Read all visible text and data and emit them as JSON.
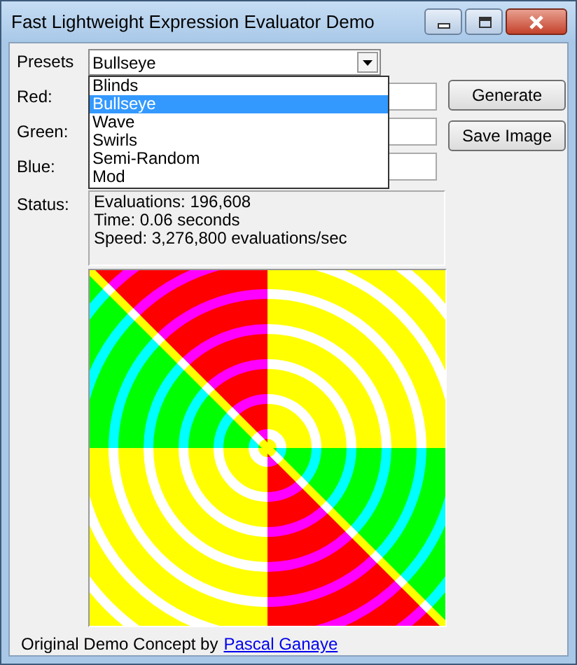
{
  "window": {
    "title": "Fast Lightweight Expression Evaluator Demo"
  },
  "presets": {
    "label": "Presets",
    "value": "Bullseye",
    "expanded": true,
    "options": [
      {
        "label": "Blinds",
        "selected": false
      },
      {
        "label": "Bullseye",
        "selected": true
      },
      {
        "label": "Wave",
        "selected": false
      },
      {
        "label": "Swirls",
        "selected": false
      },
      {
        "label": "Semi-Random",
        "selected": false
      },
      {
        "label": "Mod",
        "selected": false
      }
    ]
  },
  "fields": [
    {
      "label": "Red:"
    },
    {
      "label": "Green:"
    },
    {
      "label": "Blue:"
    }
  ],
  "buttons": [
    "Generate",
    "Save Image"
  ],
  "status": {
    "label": "Status:",
    "lines": [
      "Evaluations: 196,608",
      "Time: 0.06 seconds",
      "Speed: 3,276,800 evaluations/sec"
    ]
  },
  "footer": {
    "text": "Original Demo Concept by",
    "link": "Pascal Ganaye"
  }
}
